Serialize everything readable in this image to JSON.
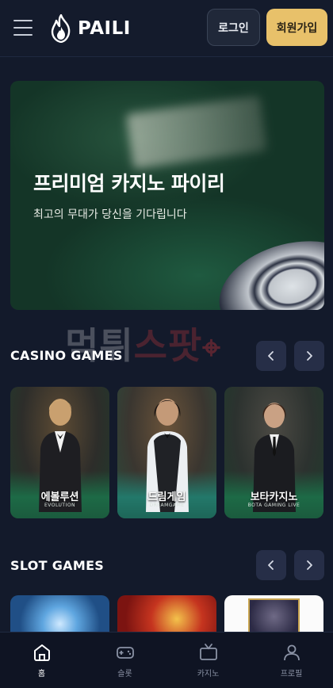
{
  "header": {
    "logo_text": "PAILI",
    "login_label": "로그인",
    "signup_label": "회원가입",
    "signup_color": "#e8c16a"
  },
  "hero": {
    "title": "프리미엄 카지노 파이리",
    "subtitle": "최고의 무대가 당신을 기다립니다"
  },
  "watermark": {
    "text_a": "먹튀",
    "text_b": "스팟"
  },
  "casino": {
    "title": "CASINO GAMES",
    "games": [
      {
        "name": "에볼루션",
        "provider": "EVOLUTION"
      },
      {
        "name": "드림게임",
        "provider": "DREAMGAME"
      },
      {
        "name": "보타카지노",
        "provider": "BOTA GAMING LIVE"
      }
    ]
  },
  "slots": {
    "title": "SLOT GAMES"
  },
  "bottom_nav": [
    {
      "label": "홈",
      "icon": "home-icon",
      "active": true
    },
    {
      "label": "슬롯",
      "icon": "gamepad-icon",
      "active": false
    },
    {
      "label": "카지노",
      "icon": "tv-icon",
      "active": false
    },
    {
      "label": "프로필",
      "icon": "user-icon",
      "active": false
    }
  ]
}
